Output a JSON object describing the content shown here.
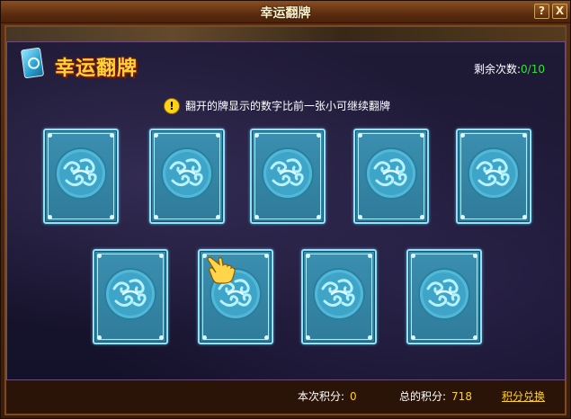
{
  "window": {
    "title": "幸运翻牌",
    "help_label": "?",
    "close_label": "X"
  },
  "header": {
    "logo_text": "幸运翻牌",
    "remaining_label": "剩余次数:",
    "remaining_value": "0/10"
  },
  "hint": {
    "icon": "!",
    "text": "翻开的牌显示的数字比前一张小可继续翻牌"
  },
  "cards": [
    {
      "id": 1,
      "state": "face-down"
    },
    {
      "id": 2,
      "state": "face-down"
    },
    {
      "id": 3,
      "state": "face-down"
    },
    {
      "id": 4,
      "state": "face-down"
    },
    {
      "id": 5,
      "state": "face-down"
    },
    {
      "id": 6,
      "state": "face-down"
    },
    {
      "id": 7,
      "state": "face-down",
      "hovered": true
    },
    {
      "id": 8,
      "state": "face-down"
    },
    {
      "id": 9,
      "state": "face-down"
    }
  ],
  "footer": {
    "current_score_label": "本次积分:",
    "current_score": "0",
    "total_score_label": "总的积分:",
    "total_score": "718",
    "exchange_label": "积分兑换"
  },
  "colors": {
    "card_fill": "#3b8fb0",
    "card_border": "#8ce5ff",
    "score_yellow": "#ffd21a",
    "count_green": "#37e03a"
  }
}
